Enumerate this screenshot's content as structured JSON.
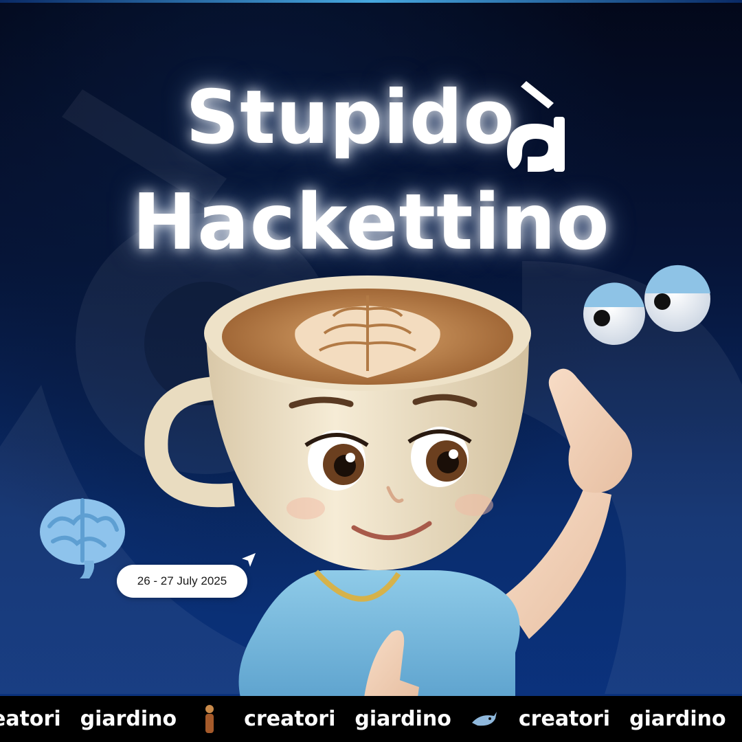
{
  "poster": {
    "title_line1": "Stupido",
    "title_line2": "Hackettino",
    "date": "26 - 27 July  2025"
  },
  "ticker": {
    "items": [
      "eatori",
      "giardino",
      "creatori",
      "giardino",
      "creatori",
      "giardino"
    ]
  },
  "colors": {
    "background_dark": "#03081a",
    "background_blue": "#0b3380",
    "title": "#ffffff",
    "ticker_bg": "#000000",
    "shirt": "#7fbfe0",
    "cup": "#f1e6cf"
  }
}
